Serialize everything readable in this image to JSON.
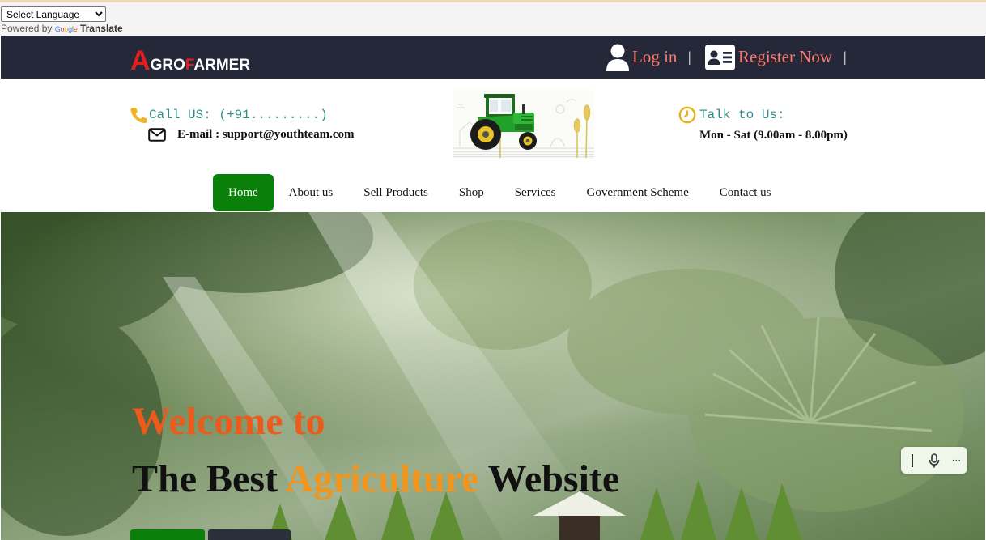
{
  "translate": {
    "select_value": "Select Language",
    "powered_by": "Powered by",
    "google": "Google",
    "translate_word": "Translate"
  },
  "brand": {
    "logo_a": "A",
    "logo_gro": "GRO",
    "logo_f": "F",
    "logo_armer": "ARMER"
  },
  "auth": {
    "login_label": "Log in",
    "register_label": "Register Now",
    "separator": "|"
  },
  "contact": {
    "call_label": "Call US: (+91.........)",
    "email_label": "E-mail : support@youthteam.com",
    "talk_label": "Talk to Us:",
    "hours": "Mon - Sat (9.00am - 8.00pm)"
  },
  "menu": {
    "items": [
      {
        "label": "Home",
        "active": true
      },
      {
        "label": "About us"
      },
      {
        "label": "Sell Products"
      },
      {
        "label": "Shop"
      },
      {
        "label": "Services"
      },
      {
        "label": "Government Scheme"
      },
      {
        "label": "Contact us"
      }
    ]
  },
  "hero": {
    "line1": "Welcome to",
    "line2_pre": "The Best",
    "line2_accent": "Agriculture",
    "line2_post": "Website"
  },
  "voice_widget": {
    "bar_icon": "text-cursor-icon",
    "mic_icon": "microphone-icon",
    "more_icon": "more-icon",
    "more_label": "···"
  },
  "colors": {
    "topbar_bg": "#242838",
    "auth_link": "#ff7a6e",
    "menu_active_bg": "#0a7f0a",
    "teal_text": "#2f8f88",
    "hero_orange": "#ec5a1c",
    "hero_amber": "#f0961e",
    "logo_red": "#e31e1e"
  }
}
